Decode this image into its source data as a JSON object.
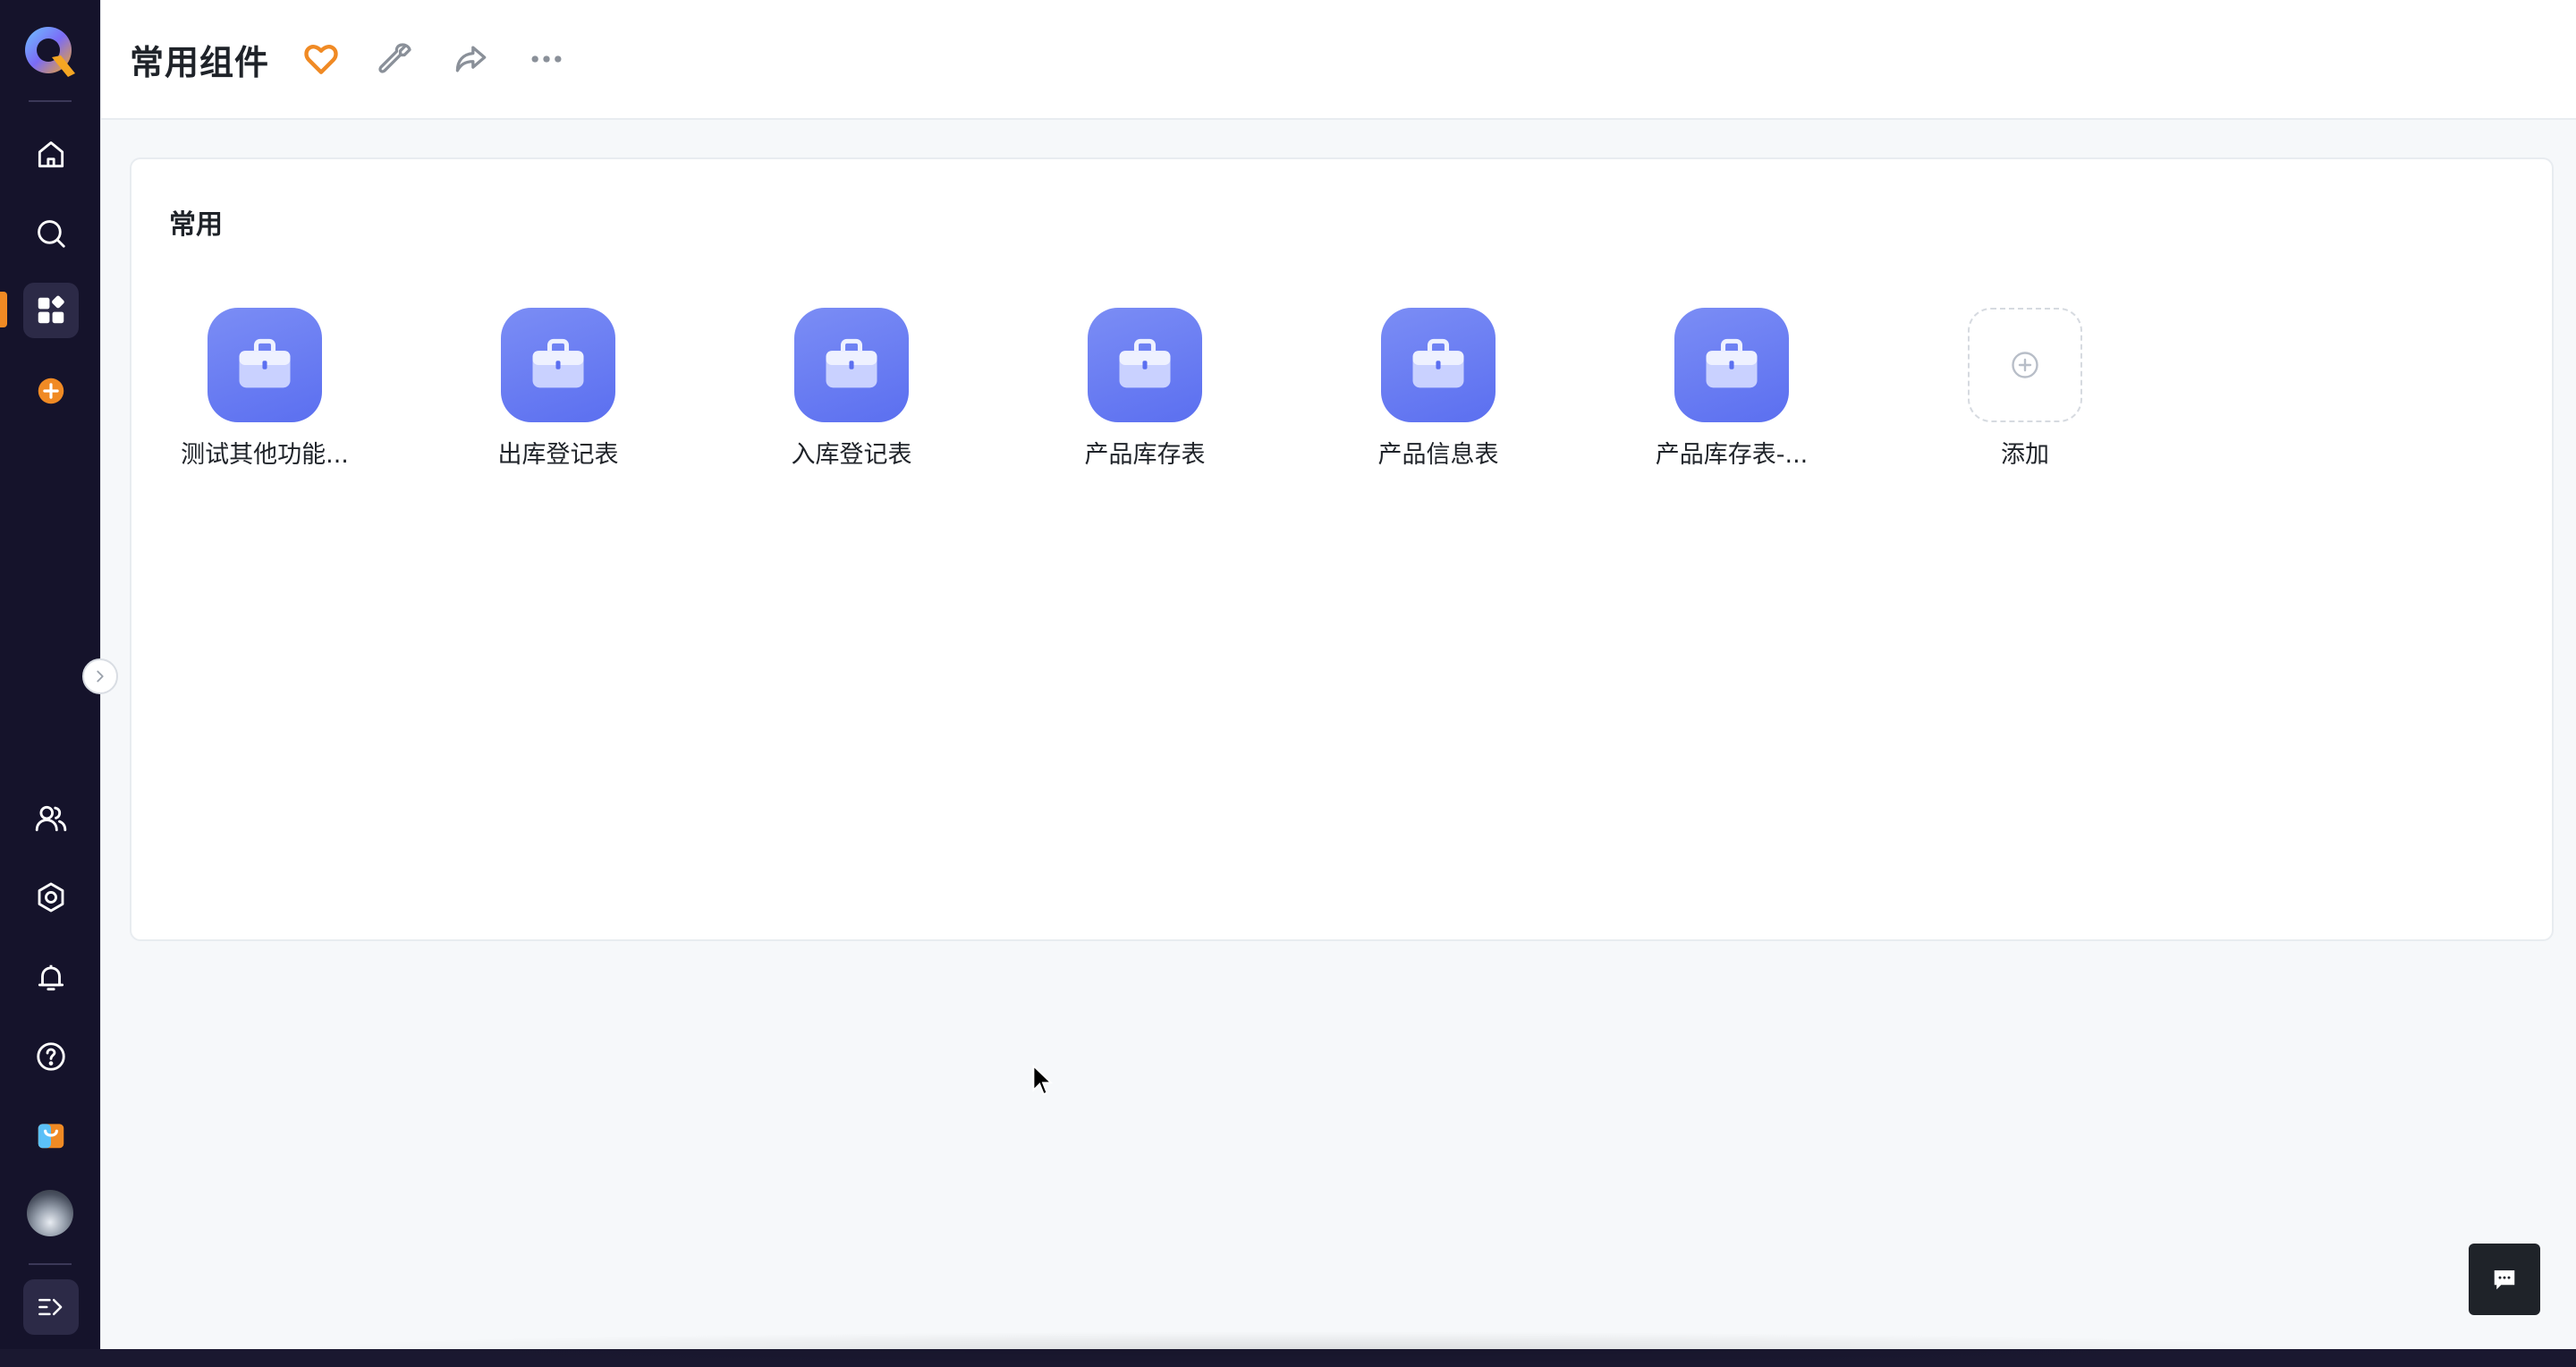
{
  "header": {
    "title": "常用组件",
    "icons": [
      "favorite-heart-icon",
      "wrench-icon",
      "share-icon",
      "more-icon"
    ]
  },
  "colors": {
    "sidebar_bg": "#15132b",
    "accent_orange": "#f08a24",
    "app_icon_blue": "#5b6ff0",
    "page_bg": "#f6f8fa"
  },
  "section": {
    "title": "常用"
  },
  "apps": [
    {
      "label": "测试其他功能..."
    },
    {
      "label": "出库登记表"
    },
    {
      "label": "入库登记表"
    },
    {
      "label": "产品库存表"
    },
    {
      "label": "产品信息表"
    },
    {
      "label": "产品库存表-..."
    }
  ],
  "add_item": {
    "label": "添加"
  },
  "sidebar": {
    "top_items": [
      "home-icon",
      "search-icon",
      "dashboard-icon",
      "add-circle-icon"
    ],
    "bottom_items": [
      "users-icon",
      "settings-icon",
      "bell-icon",
      "help-icon",
      "app-store-icon",
      "avatar",
      "expand-icon"
    ]
  }
}
